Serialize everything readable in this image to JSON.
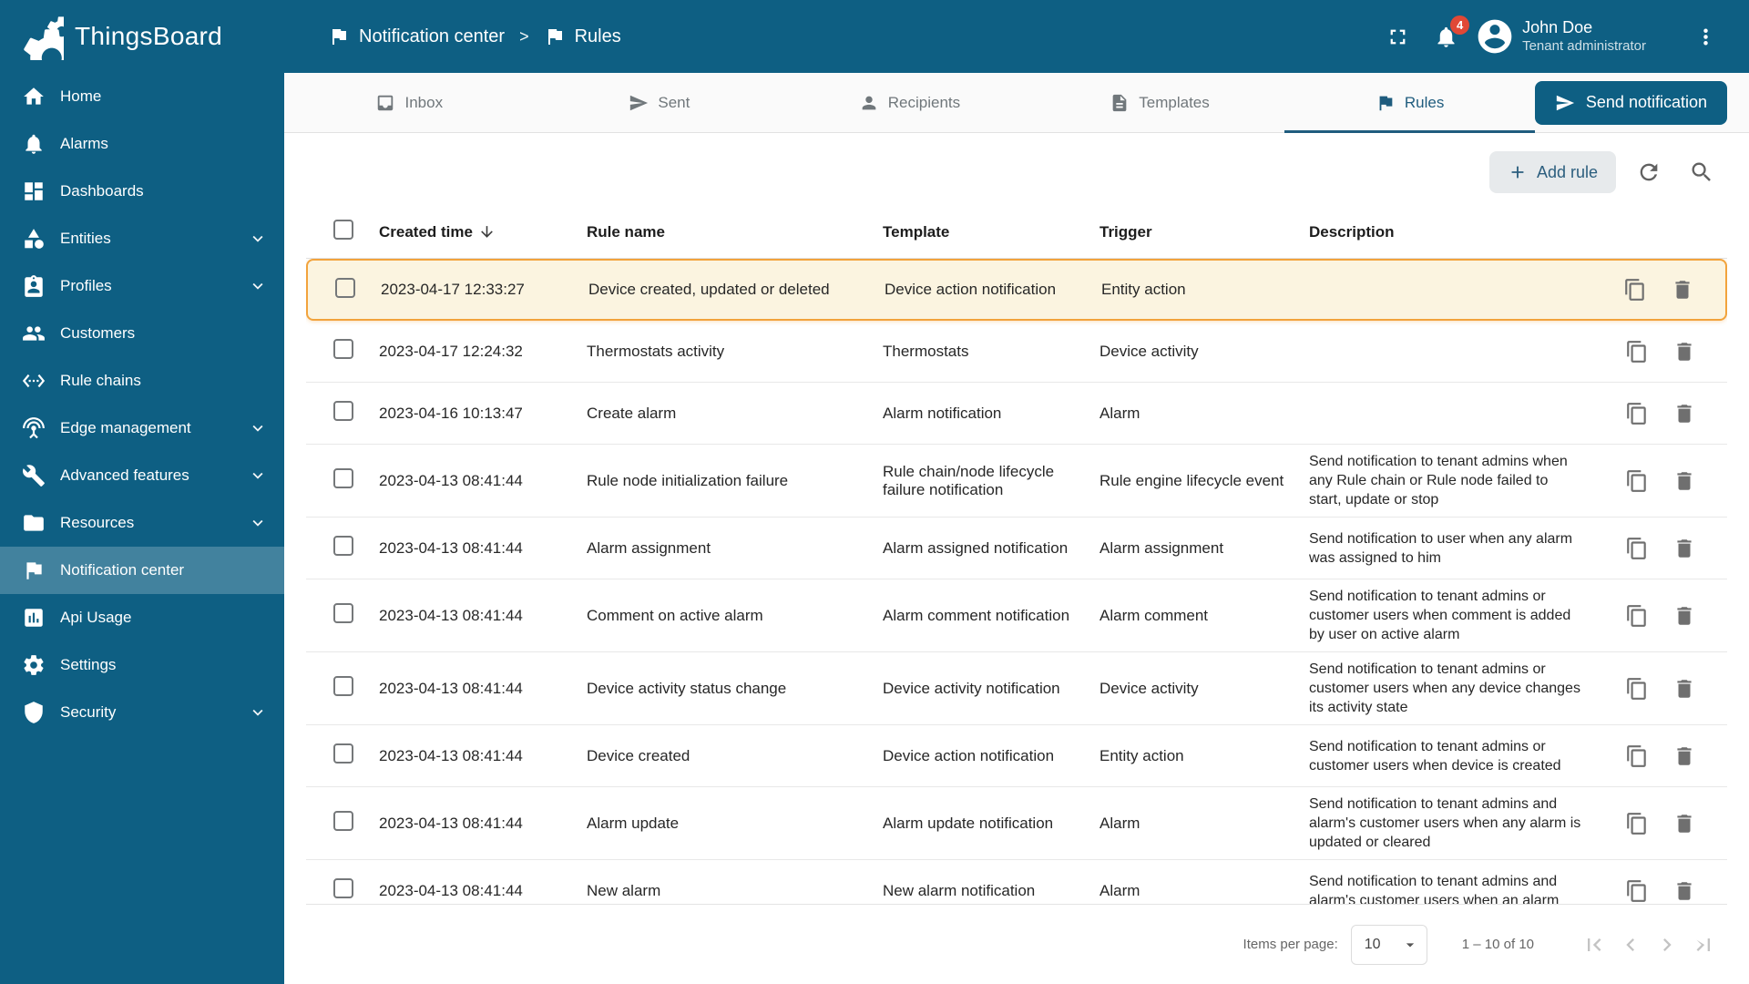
{
  "colors": {
    "primary": "#0e5f83",
    "badge": "#e04836",
    "highlight_border": "#f2a33c",
    "highlight_bg": "#fbf4e0",
    "tab_active": "#1f5c7e"
  },
  "app": {
    "title": "ThingsBoard"
  },
  "header": {
    "separator": ">",
    "breadcrumb": [
      {
        "label": "Notification center",
        "icon": "flag"
      },
      {
        "label": "Rules",
        "icon": "flag"
      }
    ],
    "notification_count": "4",
    "user": {
      "name": "John Doe",
      "role": "Tenant administrator"
    }
  },
  "sidebar": {
    "items": [
      {
        "label": "Home",
        "icon": "home"
      },
      {
        "label": "Alarms",
        "icon": "bell"
      },
      {
        "label": "Dashboards",
        "icon": "dashboard"
      },
      {
        "label": "Entities",
        "icon": "category",
        "expandable": true
      },
      {
        "label": "Profiles",
        "icon": "badge",
        "expandable": true
      },
      {
        "label": "Customers",
        "icon": "people"
      },
      {
        "label": "Rule chains",
        "icon": "ethernet"
      },
      {
        "label": "Edge management",
        "icon": "antenna",
        "expandable": true
      },
      {
        "label": "Advanced features",
        "icon": "wrench",
        "expandable": true
      },
      {
        "label": "Resources",
        "icon": "folder",
        "expandable": true
      },
      {
        "label": "Notification center",
        "icon": "flag",
        "active": true
      },
      {
        "label": "Api Usage",
        "icon": "chart-box"
      },
      {
        "label": "Settings",
        "icon": "gear"
      },
      {
        "label": "Security",
        "icon": "shield",
        "expandable": true
      }
    ]
  },
  "tabs": [
    {
      "label": "Inbox",
      "icon": "inbox"
    },
    {
      "label": "Sent",
      "icon": "send"
    },
    {
      "label": "Recipients",
      "icon": "person"
    },
    {
      "label": "Templates",
      "icon": "file"
    },
    {
      "label": "Rules",
      "icon": "flag",
      "active": true
    }
  ],
  "toolbar": {
    "send_notification": "Send notification",
    "add_rule": "Add rule"
  },
  "table": {
    "columns": {
      "created_time": "Created time",
      "rule_name": "Rule name",
      "template": "Template",
      "trigger": "Trigger",
      "description": "Description"
    },
    "rows": [
      {
        "created": "2023-04-17 12:33:27",
        "name": "Device created, updated or deleted",
        "template": "Device action notification",
        "trigger": "Entity action",
        "description": "",
        "highlighted": true
      },
      {
        "created": "2023-04-17 12:24:32",
        "name": "Thermostats activity",
        "template": "Thermostats",
        "trigger": "Device activity",
        "description": ""
      },
      {
        "created": "2023-04-16 10:13:47",
        "name": "Create alarm",
        "template": "Alarm notification",
        "trigger": "Alarm",
        "description": ""
      },
      {
        "created": "2023-04-13 08:41:44",
        "name": "Rule node initialization failure",
        "template": "Rule chain/node lifecycle failure notification",
        "trigger": "Rule engine lifecycle event",
        "description": "Send notification to tenant admins when any Rule chain or Rule node failed to start, update or stop"
      },
      {
        "created": "2023-04-13 08:41:44",
        "name": "Alarm assignment",
        "template": "Alarm assigned notification",
        "trigger": "Alarm assignment",
        "description": "Send notification to user when any alarm was assigned to him"
      },
      {
        "created": "2023-04-13 08:41:44",
        "name": "Comment on active alarm",
        "template": "Alarm comment notification",
        "trigger": "Alarm comment",
        "description": "Send notification to tenant admins or customer users when comment is added by user on active alarm"
      },
      {
        "created": "2023-04-13 08:41:44",
        "name": "Device activity status change",
        "template": "Device activity notification",
        "trigger": "Device activity",
        "description": "Send notification to tenant admins or customer users when any device changes its activity state"
      },
      {
        "created": "2023-04-13 08:41:44",
        "name": "Device created",
        "template": "Device action notification",
        "trigger": "Entity action",
        "description": "Send notification to tenant admins or customer users when device is created"
      },
      {
        "created": "2023-04-13 08:41:44",
        "name": "Alarm update",
        "template": "Alarm update notification",
        "trigger": "Alarm",
        "description": "Send notification to tenant admins and alarm's customer users when any alarm is updated or cleared"
      },
      {
        "created": "2023-04-13 08:41:44",
        "name": "New alarm",
        "template": "New alarm notification",
        "trigger": "Alarm",
        "description": "Send notification to tenant admins and alarm's customer users when an alarm"
      }
    ]
  },
  "pagination": {
    "items_per_page_label": "Items per page:",
    "items_per_page_value": "10",
    "range_label": "1 – 10 of 10"
  }
}
